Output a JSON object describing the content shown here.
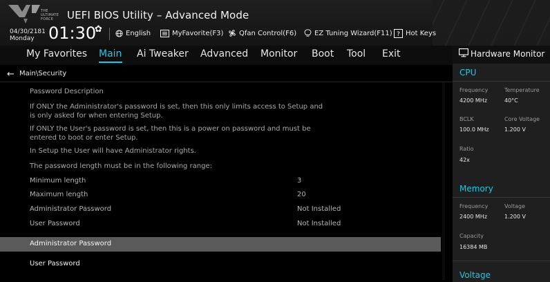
{
  "header": {
    "logo_brand": [
      "THE",
      "ULTIMATE",
      "FORCE"
    ],
    "title": "UEFI BIOS Utility – Advanced Mode",
    "date": "04/30/2181",
    "day": "Monday",
    "time": "01:30",
    "items": [
      {
        "icon": "globe-icon",
        "label": "English"
      },
      {
        "icon": "favorite-list-icon",
        "label": "MyFavorite(F3)"
      },
      {
        "icon": "fan-icon",
        "label": "Qfan Control(F6)"
      },
      {
        "icon": "lightbulb-icon",
        "label": "EZ Tuning Wizard(F11)"
      },
      {
        "icon": "question-box-icon",
        "label": "Hot Keys"
      }
    ]
  },
  "nav": {
    "tabs": [
      "My Favorites",
      "Main",
      "Ai Tweaker",
      "Advanced",
      "Monitor",
      "Boot",
      "Tool",
      "Exit"
    ],
    "active": "Main"
  },
  "main": {
    "breadcrumb": "Main\\Security",
    "description": [
      "Password Description",
      "If ONLY the Administrator's password is set, then this only limits access to Setup and",
      "is only asked for when entering Setup.",
      "If ONLY the User's password is set, then this is a power on password and must be",
      "entered to boot or enter Setup.",
      "In Setup the User will have Administrator rights.",
      "The password length must be in the following range:"
    ],
    "settings": [
      {
        "label": "Minimum length",
        "value": "3"
      },
      {
        "label": "Maximum length",
        "value": "20"
      },
      {
        "label": "Administrator Password",
        "value": "Not Installed"
      },
      {
        "label": "User Password",
        "value": "Not Installed"
      }
    ],
    "selected_item": "Administrator Password",
    "items_after": [
      "User Password"
    ]
  },
  "hw_monitor": {
    "title": "Hardware Monitor",
    "cpu": {
      "section": "CPU",
      "frequency_label": "Frequency",
      "frequency": "4200 MHz",
      "temperature_label": "Temperature",
      "temperature": "40°C",
      "bclk_label": "BCLK",
      "bclk": "100.0 MHz",
      "core_voltage_label": "Core Voltage",
      "core_voltage": "1.200 V",
      "ratio_label": "Ratio",
      "ratio": "42x"
    },
    "memory": {
      "section": "Memory",
      "frequency_label": "Frequency",
      "frequency": "2400 MHz",
      "voltage_label": "Voltage",
      "voltage": "1.200 V",
      "capacity_label": "Capacity",
      "capacity": "16384 MB"
    },
    "voltage": {
      "section": "Voltage"
    }
  },
  "colors": {
    "accent": "#1fc8e6",
    "selected_row": "#5a5a5a",
    "panel": "#1f1f1f",
    "background": "#000000"
  }
}
